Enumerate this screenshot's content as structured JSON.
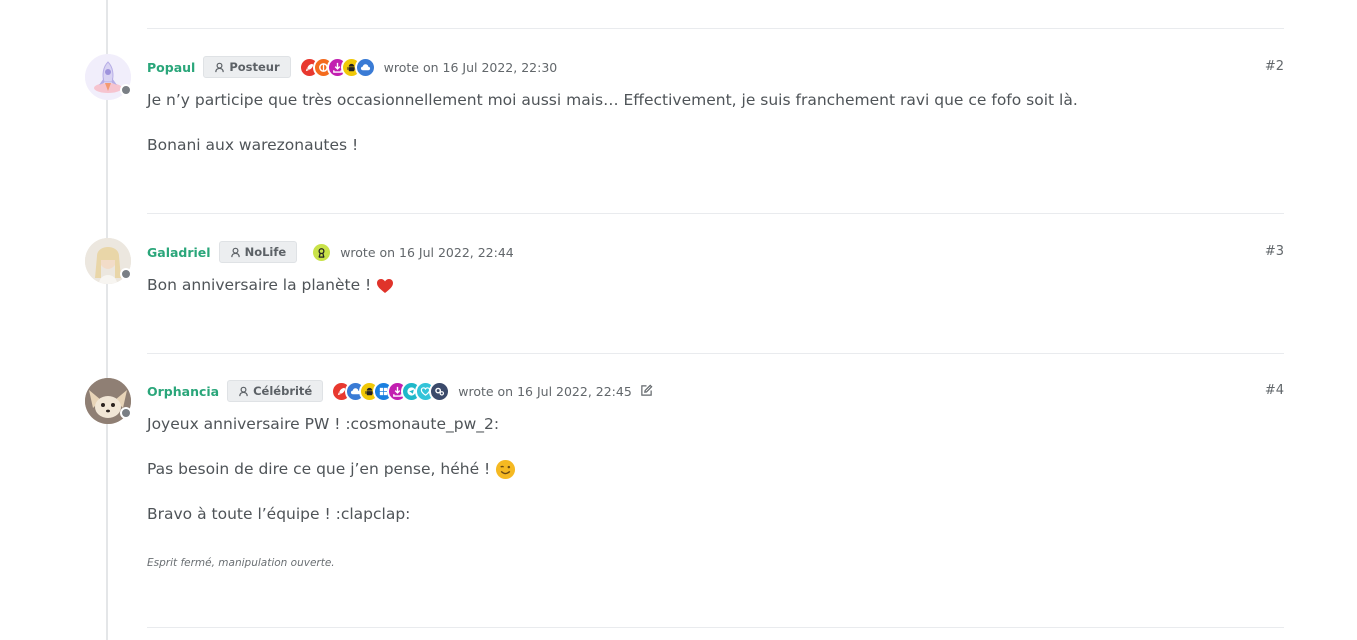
{
  "posts": [
    {
      "username": "Popaul",
      "group": "Posteur",
      "badges": [
        {
          "icon": "rocket-icon",
          "color": "#e8382f"
        },
        {
          "icon": "rebel-icon",
          "color": "#f46b1e"
        },
        {
          "icon": "download-icon",
          "color": "#c21fb0"
        },
        {
          "icon": "android-icon",
          "color": "#f0c808"
        },
        {
          "icon": "cloud-upload-icon",
          "color": "#3a7bd5"
        }
      ],
      "timestamp": "wrote on 16 Jul 2022, 22:30",
      "index": "#2",
      "paragraphs": [
        "Je n’y participe que très occasionnellement moi aussi mais… Effectivement, je suis franchement ravi que ce fofo soit là.",
        "Bonani aux warezonautes !"
      ]
    },
    {
      "username": "Galadriel",
      "group": "NoLife",
      "badges": [
        {
          "icon": "user-award-icon",
          "color": "#c9e24a"
        }
      ],
      "timestamp": "wrote on 16 Jul 2022, 22:44",
      "index": "#3",
      "paragraphs": [
        "Bon anniversaire la planète !"
      ]
    },
    {
      "username": "Orphancia",
      "group": "Célébrité",
      "badges": [
        {
          "icon": "rocket-icon",
          "color": "#e8382f"
        },
        {
          "icon": "cloud-upload-icon",
          "color": "#3a7bd5"
        },
        {
          "icon": "android-icon",
          "color": "#f0c808"
        },
        {
          "icon": "windows-icon",
          "color": "#1a7fe0"
        },
        {
          "icon": "download-icon",
          "color": "#c21fb0"
        },
        {
          "icon": "telegram-icon",
          "color": "#1fb8c9"
        },
        {
          "icon": "heart-outline-icon",
          "color": "#33c4d9"
        },
        {
          "icon": "gears-icon",
          "color": "#3b4a6b"
        }
      ],
      "timestamp": "wrote on 16 Jul 2022, 22:45",
      "index": "#4",
      "paragraphs": [
        "Joyeux anniversaire PW ! :cosmonaute_pw_2:",
        "Pas besoin de dire ce que j’en pense, héhé !",
        "Bravo à toute l’équipe ! :clapclap:"
      ],
      "signature": "Esprit fermé, manipulation ouverte."
    }
  ],
  "colors": {
    "username": "#2aa67a",
    "heart": "#e0332a",
    "smiley": "#f5b922"
  }
}
